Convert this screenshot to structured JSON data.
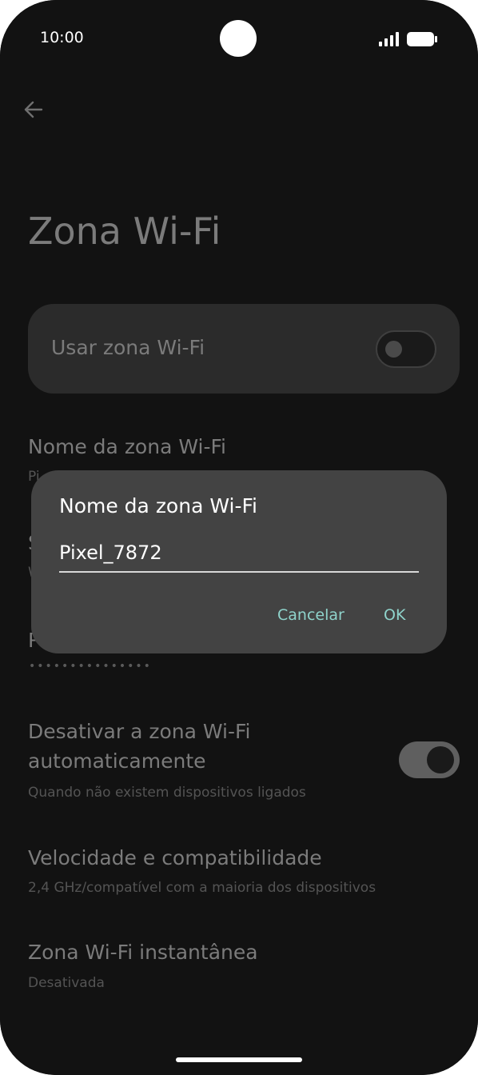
{
  "status_bar": {
    "time": "10:00"
  },
  "header": {
    "title": "Zona Wi-Fi"
  },
  "toggle_card": {
    "label": "Usar zona Wi-Fi",
    "state": "off"
  },
  "settings": {
    "name": {
      "title": "Nome da zona Wi-Fi",
      "subtitle": "Pi"
    },
    "security": {
      "title": "S",
      "subtitle": "W"
    },
    "password": {
      "title": "P",
      "value": "•••••••••••••••"
    },
    "auto_off": {
      "title_line1": "Desativar a zona Wi-Fi",
      "title_line2": "automaticamente",
      "subtitle": "Quando não existem dispositivos ligados",
      "state": "on"
    },
    "speed": {
      "title": "Velocidade e compatibilidade",
      "subtitle": "2,4 GHz/compatível com a maioria dos dispositivos"
    },
    "instant": {
      "title": "Zona Wi-Fi instantânea",
      "subtitle": "Desativada"
    }
  },
  "dialog": {
    "title": "Nome da zona Wi-Fi",
    "input_value": "Pixel_7872",
    "cancel_label": "Cancelar",
    "ok_label": "OK"
  },
  "colors": {
    "accent": "#8fd3cb",
    "background": "#121212",
    "dialog": "#434343"
  }
}
